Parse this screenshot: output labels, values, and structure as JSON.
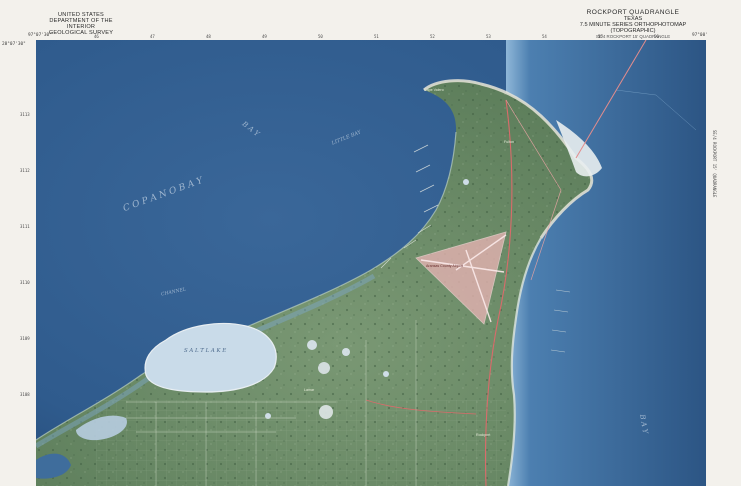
{
  "header": {
    "agency": [
      "UNITED STATES",
      "DEPARTMENT OF THE INTERIOR",
      "GEOLOGICAL SURVEY"
    ],
    "quadrangle": "ROCKPORT QUADRANGLE",
    "state": "TEXAS",
    "series": "7.5 MINUTE SERIES ORTHOPHOTOMAP (TOPOGRAPHIC)",
    "note": "SE/4 ROCKPORT 15' QUADRANGLE"
  },
  "coords": {
    "top_left": "97°07'30\"",
    "top_right": "97°00'",
    "lat_left": "28°07'30\"",
    "top_ticks": [
      "46",
      "47",
      "48",
      "49",
      "50",
      "51",
      "52",
      "53",
      "54",
      "55",
      "56"
    ],
    "left_ticks": [
      "3113",
      "3112",
      "3111",
      "3110",
      "3109",
      "3108"
    ]
  },
  "water": {
    "copano_bay": "C O P A N O    B A Y",
    "bay": "B A Y",
    "little_bay": "LITTLE BAY",
    "salt_lake": "S A L T      L A K E",
    "aransas_bay": "B A Y",
    "channel": "CHANNEL",
    "inlet_label": "Cape Valero"
  },
  "land": {
    "fulton": "Fulton",
    "rockport": "Rockport",
    "airport": "Aransas County Airport",
    "lamar": "Lamar"
  },
  "colors": {
    "deep_water": "#2f5b8d",
    "shallow_water": "#8fb7d8",
    "land": "#6d8d68",
    "sand": "#e6e4d8",
    "airport": "#e7b3b3",
    "road": "#d96b6b",
    "margin": "#f3f1ec"
  }
}
